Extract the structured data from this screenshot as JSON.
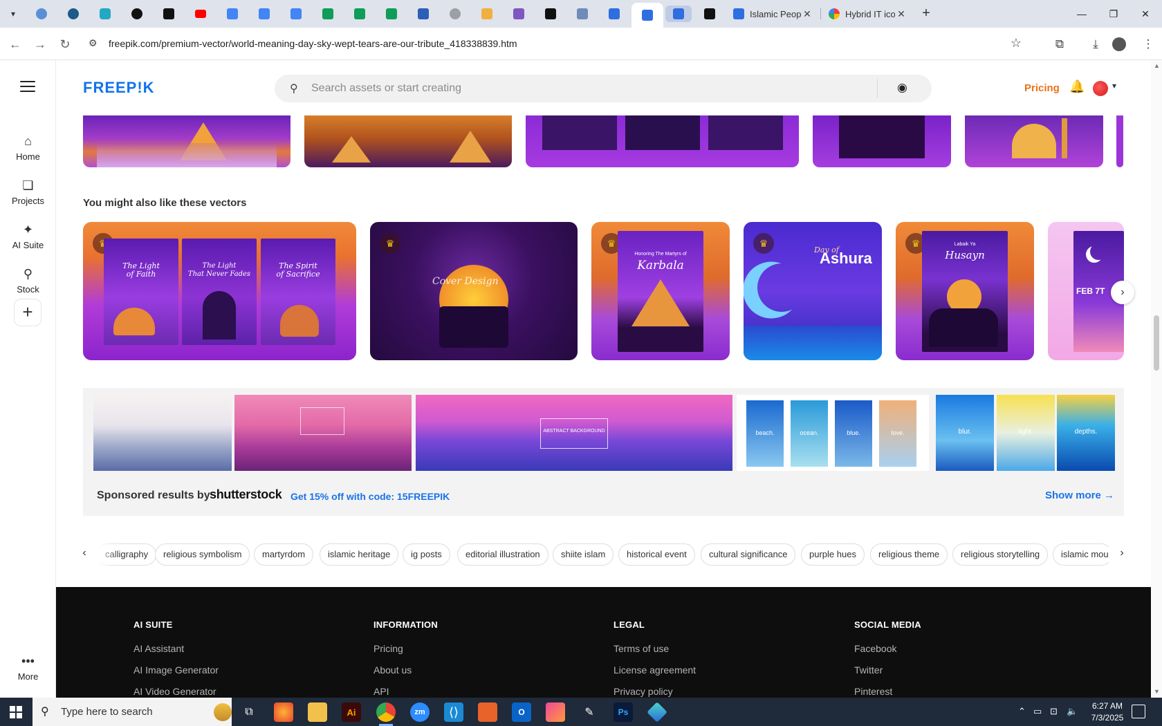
{
  "browser": {
    "tabs": [
      {
        "title": "Islamic Peop",
        "icon": "doc-icon"
      },
      {
        "title": "Hybrid IT ico",
        "icon": "google-icon"
      }
    ],
    "url": "freepik.com/premium-vector/world-meaning-day-sky-wept-tears-are-our-tribute_418338839.htm"
  },
  "header": {
    "logo": "FREEP!K",
    "search_placeholder": "Search assets or start creating",
    "pricing": "Pricing"
  },
  "sidebar": {
    "items": [
      {
        "label": "Home",
        "icon": "home-icon"
      },
      {
        "label": "Projects",
        "icon": "projects-icon"
      },
      {
        "label": "AI Suite",
        "icon": "sparkle-icon"
      },
      {
        "label": "Stock",
        "icon": "stock-icon"
      }
    ],
    "more": "More"
  },
  "main": {
    "section_title": "You might also like these vectors",
    "cards": [
      {
        "posters": [
          {
            "lines": [
              "The Light",
              "of Faith"
            ]
          },
          {
            "lines": [
              "The Light",
              "That Never Fades"
            ]
          },
          {
            "lines": [
              "The Spirit",
              "of Sacrifice"
            ]
          }
        ]
      },
      {
        "text": "Cover Design"
      },
      {
        "small": "Honoring The Martyrs of",
        "big": "Karbala"
      },
      {
        "small": "Day of",
        "big": "Ashura"
      },
      {
        "small": "Labaik Ya",
        "big": "Husayn"
      },
      {
        "date": "FEB 7T"
      }
    ]
  },
  "sponsored": {
    "label": "Sponsored results by",
    "brand": "shutterstock",
    "promo": "Get 15% off with code: 15FREEPIK",
    "show_more": "Show more",
    "tiles": [
      "beach.",
      "ocean.",
      "blue.",
      "love.",
      "blur.",
      "light.",
      "depths."
    ],
    "banner_text": "ABSTRACT BACKGROUND"
  },
  "tags": [
    "calligraphy",
    "religious symbolism",
    "martyrdom",
    "islamic heritage",
    "ig posts",
    "editorial illustration",
    "shiite islam",
    "historical event",
    "cultural significance",
    "purple hues",
    "religious theme",
    "religious storytelling",
    "islamic mou"
  ],
  "footer": {
    "columns": [
      {
        "heading": "AI SUITE",
        "links": [
          "AI Assistant",
          "AI Image Generator",
          "AI Video Generator"
        ]
      },
      {
        "heading": "INFORMATION",
        "links": [
          "Pricing",
          "About us",
          "API"
        ]
      },
      {
        "heading": "LEGAL",
        "links": [
          "Terms of use",
          "License agreement",
          "Privacy policy"
        ]
      },
      {
        "heading": "SOCIAL MEDIA",
        "links": [
          "Facebook",
          "Twitter",
          "Pinterest"
        ]
      }
    ]
  },
  "taskbar": {
    "search_placeholder": "Type here to search",
    "time": "6:27 AM",
    "date": "7/3/2025"
  }
}
